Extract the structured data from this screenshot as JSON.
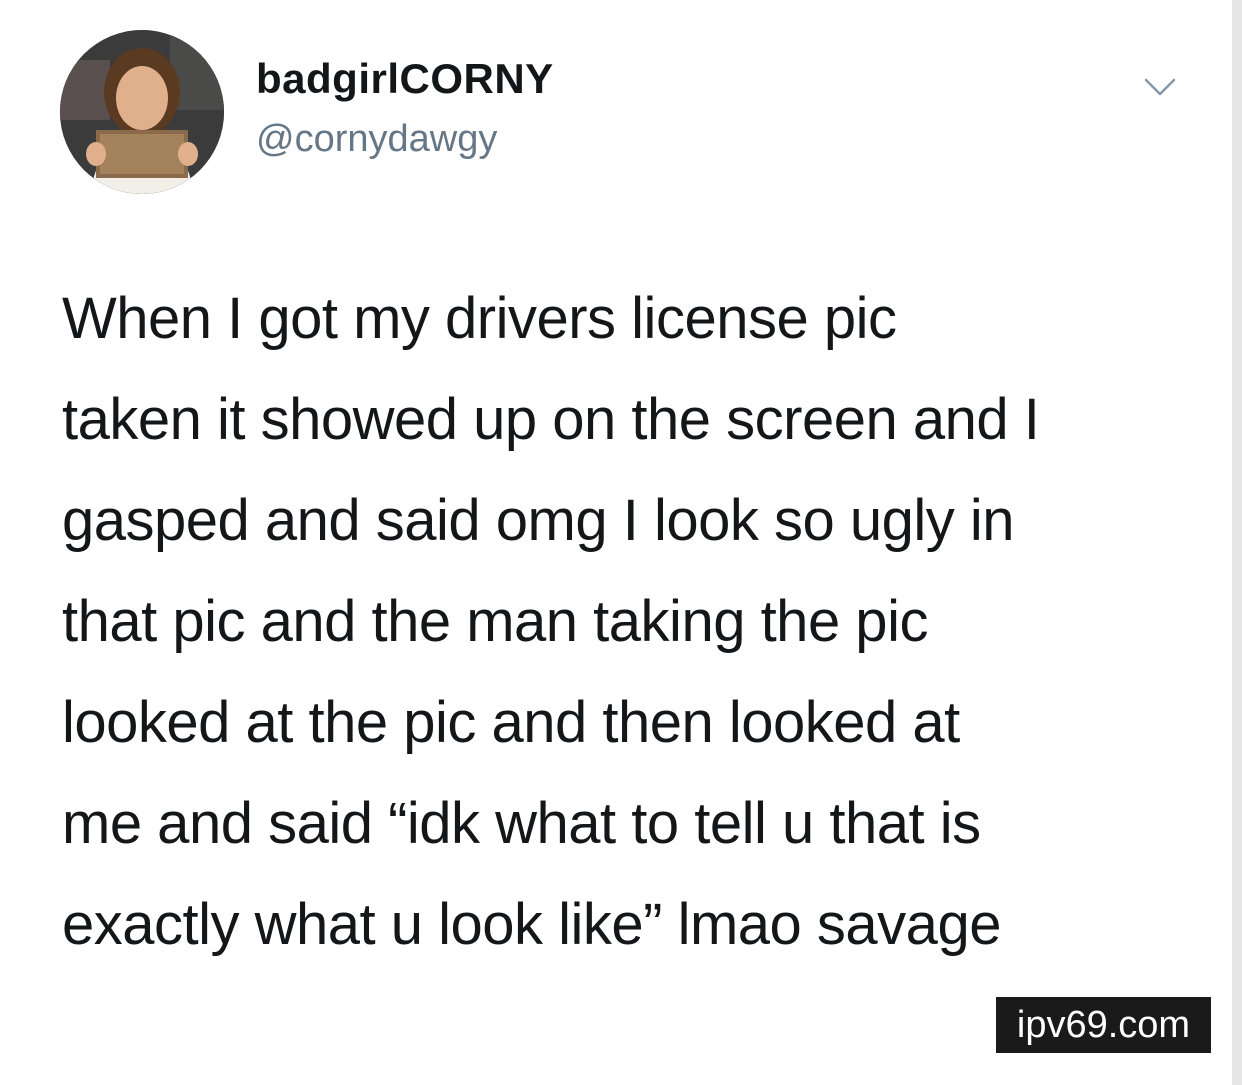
{
  "user": {
    "display_name": "badgirlCORNY",
    "handle": "@cornydawgy"
  },
  "tweet": {
    "lines": [
      "When I got my drivers license pic",
      "taken it showed up on the screen and I",
      "gasped and said omg I look so ugly in",
      "that pic and the man taking the pic",
      "looked at the pic and then looked at",
      "me and said “idk what to tell u that is",
      "exactly what u look like” lmao savage"
    ]
  },
  "icons": {
    "menu": "chevron-down-icon"
  },
  "watermark": {
    "text": "ipv69.com"
  },
  "colors": {
    "text": "#14171a",
    "handle": "#657786",
    "background": "#ffffff"
  }
}
